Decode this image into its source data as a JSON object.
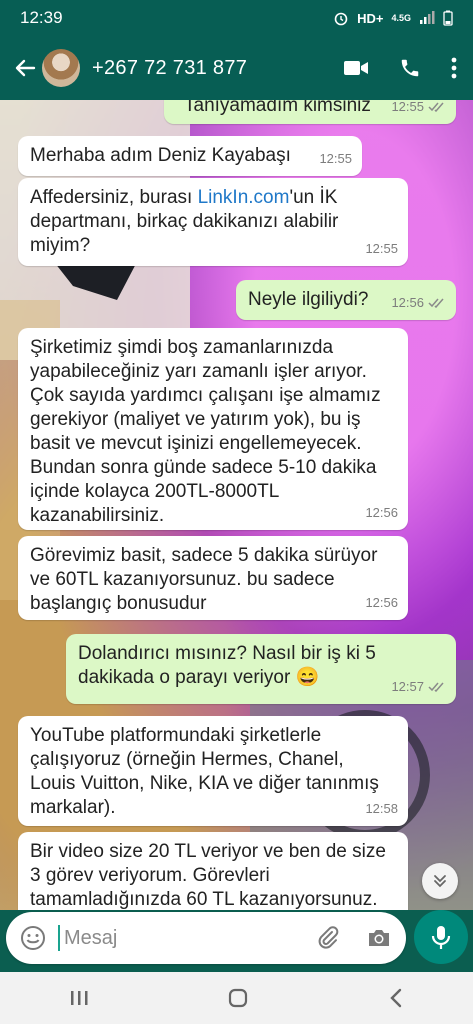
{
  "status": {
    "time": "12:39",
    "network": "HD+",
    "network_sub": "4.5G"
  },
  "header": {
    "contact": "+267 72 731 877"
  },
  "messages": [
    {
      "dir": "out",
      "text": "Tanıyamadım kimsiniz",
      "time": "12:55",
      "ticks": true
    },
    {
      "dir": "in",
      "text": "Merhaba adım Deniz Kayabaşı",
      "time": "12:55"
    },
    {
      "dir": "in",
      "text_pre": "Affedersiniz, burası ",
      "link": "LinkIn.com",
      "text_post": "'un İK departmanı, birkaç dakikanızı alabilir miyim?",
      "time": "12:55"
    },
    {
      "dir": "out",
      "text": "Neyle ilgiliydi?",
      "time": "12:56",
      "ticks": true
    },
    {
      "dir": "in",
      "text": "Şirketimiz şimdi boş zamanlarınızda yapabileceğiniz yarı zamanlı işler arıyor. Çok sayıda yardımcı çalışanı işe almamız gerekiyor (maliyet ve yatırım yok), bu iş basit ve mevcut işinizi engellemeyecek. Bundan sonra günde sadece 5-10 dakika içinde kolayca 200TL-8000TL kazanabilirsiniz.",
      "time": "12:56"
    },
    {
      "dir": "in",
      "text": "Görevimiz basit, sadece 5 dakika sürüyor ve 60TL kazanıyorsunuz. bu sadece başlangıç bonusudur",
      "time": "12:56"
    },
    {
      "dir": "out",
      "text": "Dolandırıcı mısınız? Nasıl bir iş ki 5 dakikada o parayı veriyor 😄",
      "time": "12:57",
      "ticks": true
    },
    {
      "dir": "in",
      "text": "YouTube platformundaki şirketlerle çalışıyoruz (örneğin Hermes, Chanel, Louis Vuitton, Nike, KIA ve diğer tanınmış markalar).",
      "time": "12:58"
    },
    {
      "dir": "in",
      "text": "Bir video size 20 TL veriyor ve ben de size 3 görev veriyorum. Görevleri tamamladığınızda 60 TL kazanıyorsunuz.",
      "time": ""
    }
  ],
  "composer": {
    "placeholder": "Mesaj"
  },
  "colors": {
    "header": "#075e54",
    "outgoing": "#dcf8c6",
    "incoming": "#ffffff",
    "link": "#1f78c8",
    "mic": "#00897b"
  },
  "icons": [
    "back-arrow-icon",
    "video-call-icon",
    "phone-icon",
    "more-vert-icon",
    "emoji-icon",
    "attach-icon",
    "camera-icon",
    "mic-icon",
    "scroll-down-icon",
    "nav-recents-icon",
    "nav-home-icon",
    "nav-back-icon"
  ]
}
